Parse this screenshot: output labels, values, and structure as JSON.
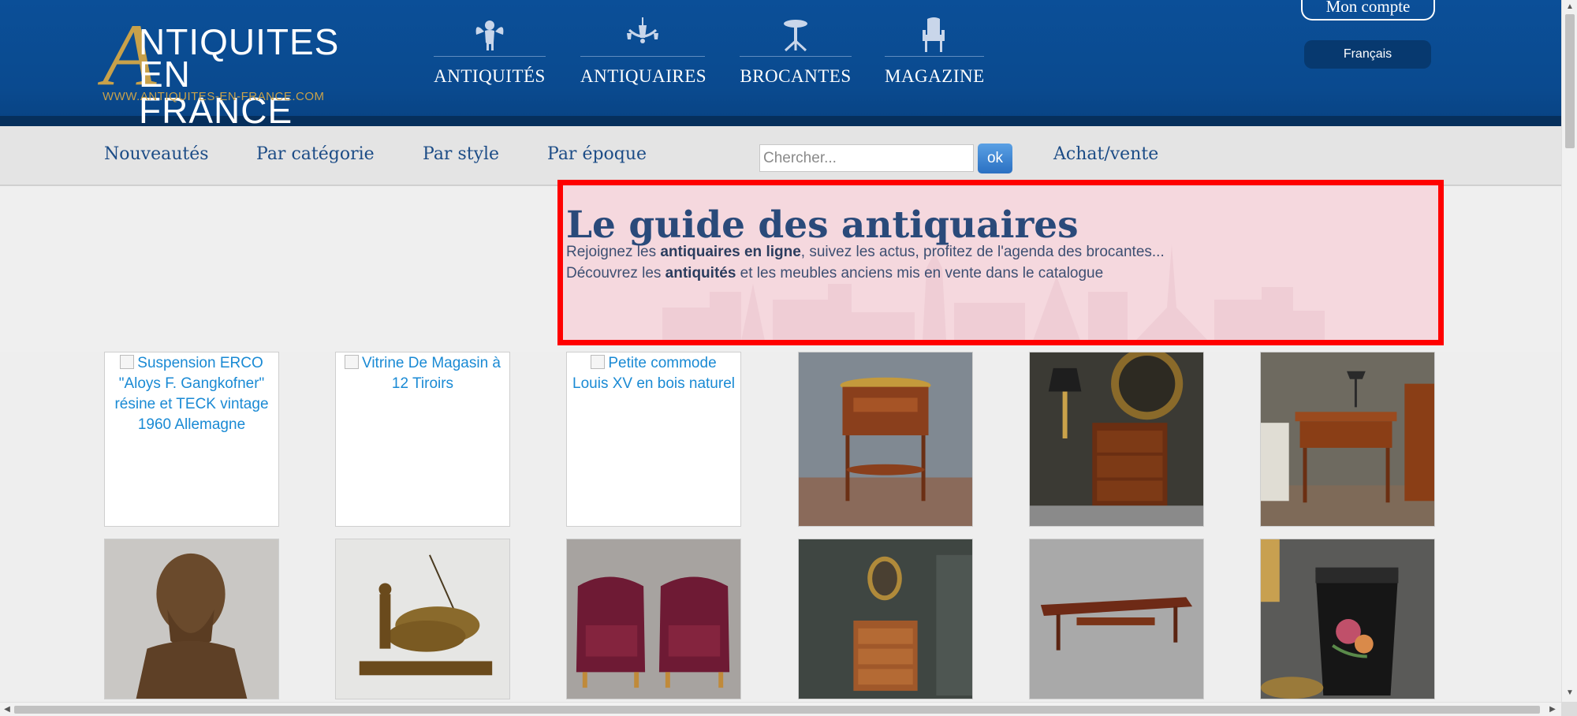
{
  "logo": {
    "letter": "A",
    "line1": "NTIQUITES",
    "line2": "EN FRANCE",
    "url": "WWW.ANTIQUITES-EN-FRANCE.COM"
  },
  "main_nav": [
    {
      "label": "ANTIQUITÉS",
      "icon": "cherub-icon"
    },
    {
      "label": "ANTIQUAIRES",
      "icon": "chandelier-icon"
    },
    {
      "label": "BROCANTES",
      "icon": "pedestal-table-icon"
    },
    {
      "label": "MAGAZINE",
      "icon": "armchair-icon"
    }
  ],
  "account": {
    "label": "Mon compte"
  },
  "language": {
    "label": "Français"
  },
  "subnav": {
    "links": [
      "Nouveautés",
      "Par catégorie",
      "Par style",
      "Par époque"
    ],
    "search_placeholder": "Chercher...",
    "search_button": "ok",
    "achat_vente": "Achat/vente"
  },
  "hero": {
    "title": "Le guide des antiquaires",
    "line1_pre": "Rejoignez les ",
    "line1_bold": "antiquaires en ligne",
    "line1_post": ", suivez les actus, profitez de l'agenda des brocantes...",
    "line2_pre": "Découvrez les ",
    "line2_bold": "antiquités",
    "line2_post": " et les meubles anciens mis en vente dans le catalogue"
  },
  "products_row1": [
    {
      "alt": "Suspension ERCO \"Aloys F. Gangkofner\" résine et TECK vintage 1960 Allemagne",
      "broken": true
    },
    {
      "alt": "Vitrine De Magasin à 12 Tiroirs",
      "broken": true
    },
    {
      "alt": "Petite commode Louis XV en bois naturel",
      "broken": true
    },
    {
      "photo": "oval-side-table-photo",
      "broken": false
    },
    {
      "photo": "bedside-chest-with-candelabra-photo",
      "broken": false
    },
    {
      "photo": "writing-table-photo",
      "broken": false
    }
  ],
  "products_row2": [
    {
      "photo": "bronze-bust-photo"
    },
    {
      "photo": "bronze-oxen-sculpture-photo"
    },
    {
      "photo": "pair-of-velvet-armchairs-photo"
    },
    {
      "photo": "chest-with-portrait-photo"
    },
    {
      "photo": "teak-coffee-table-photo"
    },
    {
      "photo": "painted-tole-vase-photo"
    }
  ],
  "colors": {
    "header_blue": "#0b4f98",
    "gold": "#c8a14a",
    "link_blue": "#1c4c86",
    "highlight_red": "#ff0000"
  }
}
